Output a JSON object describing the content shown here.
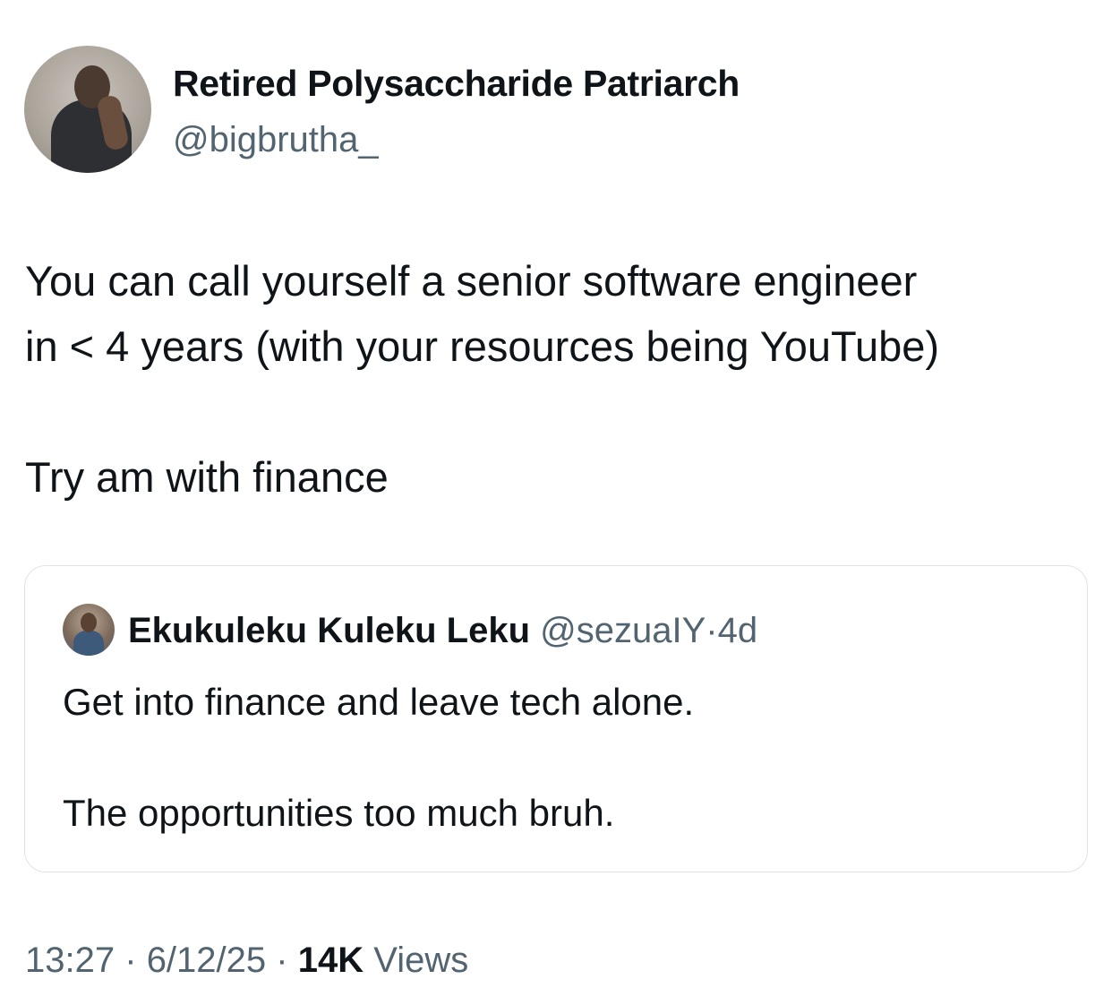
{
  "author": {
    "display_name": "Retired Polysaccharide Patriarch",
    "handle": "@bigbrutha_"
  },
  "tweet": {
    "lines": [
      "You can call yourself a senior software engineer",
      "in < 4 years (with your resources being YouTube)",
      "Try am with finance"
    ]
  },
  "quoted_tweet": {
    "display_name": "Ekukuleku Kuleku Leku",
    "handle": "@sezuaIY",
    "separator": "·",
    "time": "4d",
    "lines": [
      "Get into finance and leave tech alone.",
      "The opportunities too much bruh."
    ]
  },
  "meta": {
    "time": "13:27",
    "separator": "·",
    "date": "6/12/25",
    "views_count": "14K",
    "views_label": "Views"
  },
  "colors": {
    "text_primary": "#0f1419",
    "text_secondary": "#536471",
    "border": "#dfe3e7"
  }
}
